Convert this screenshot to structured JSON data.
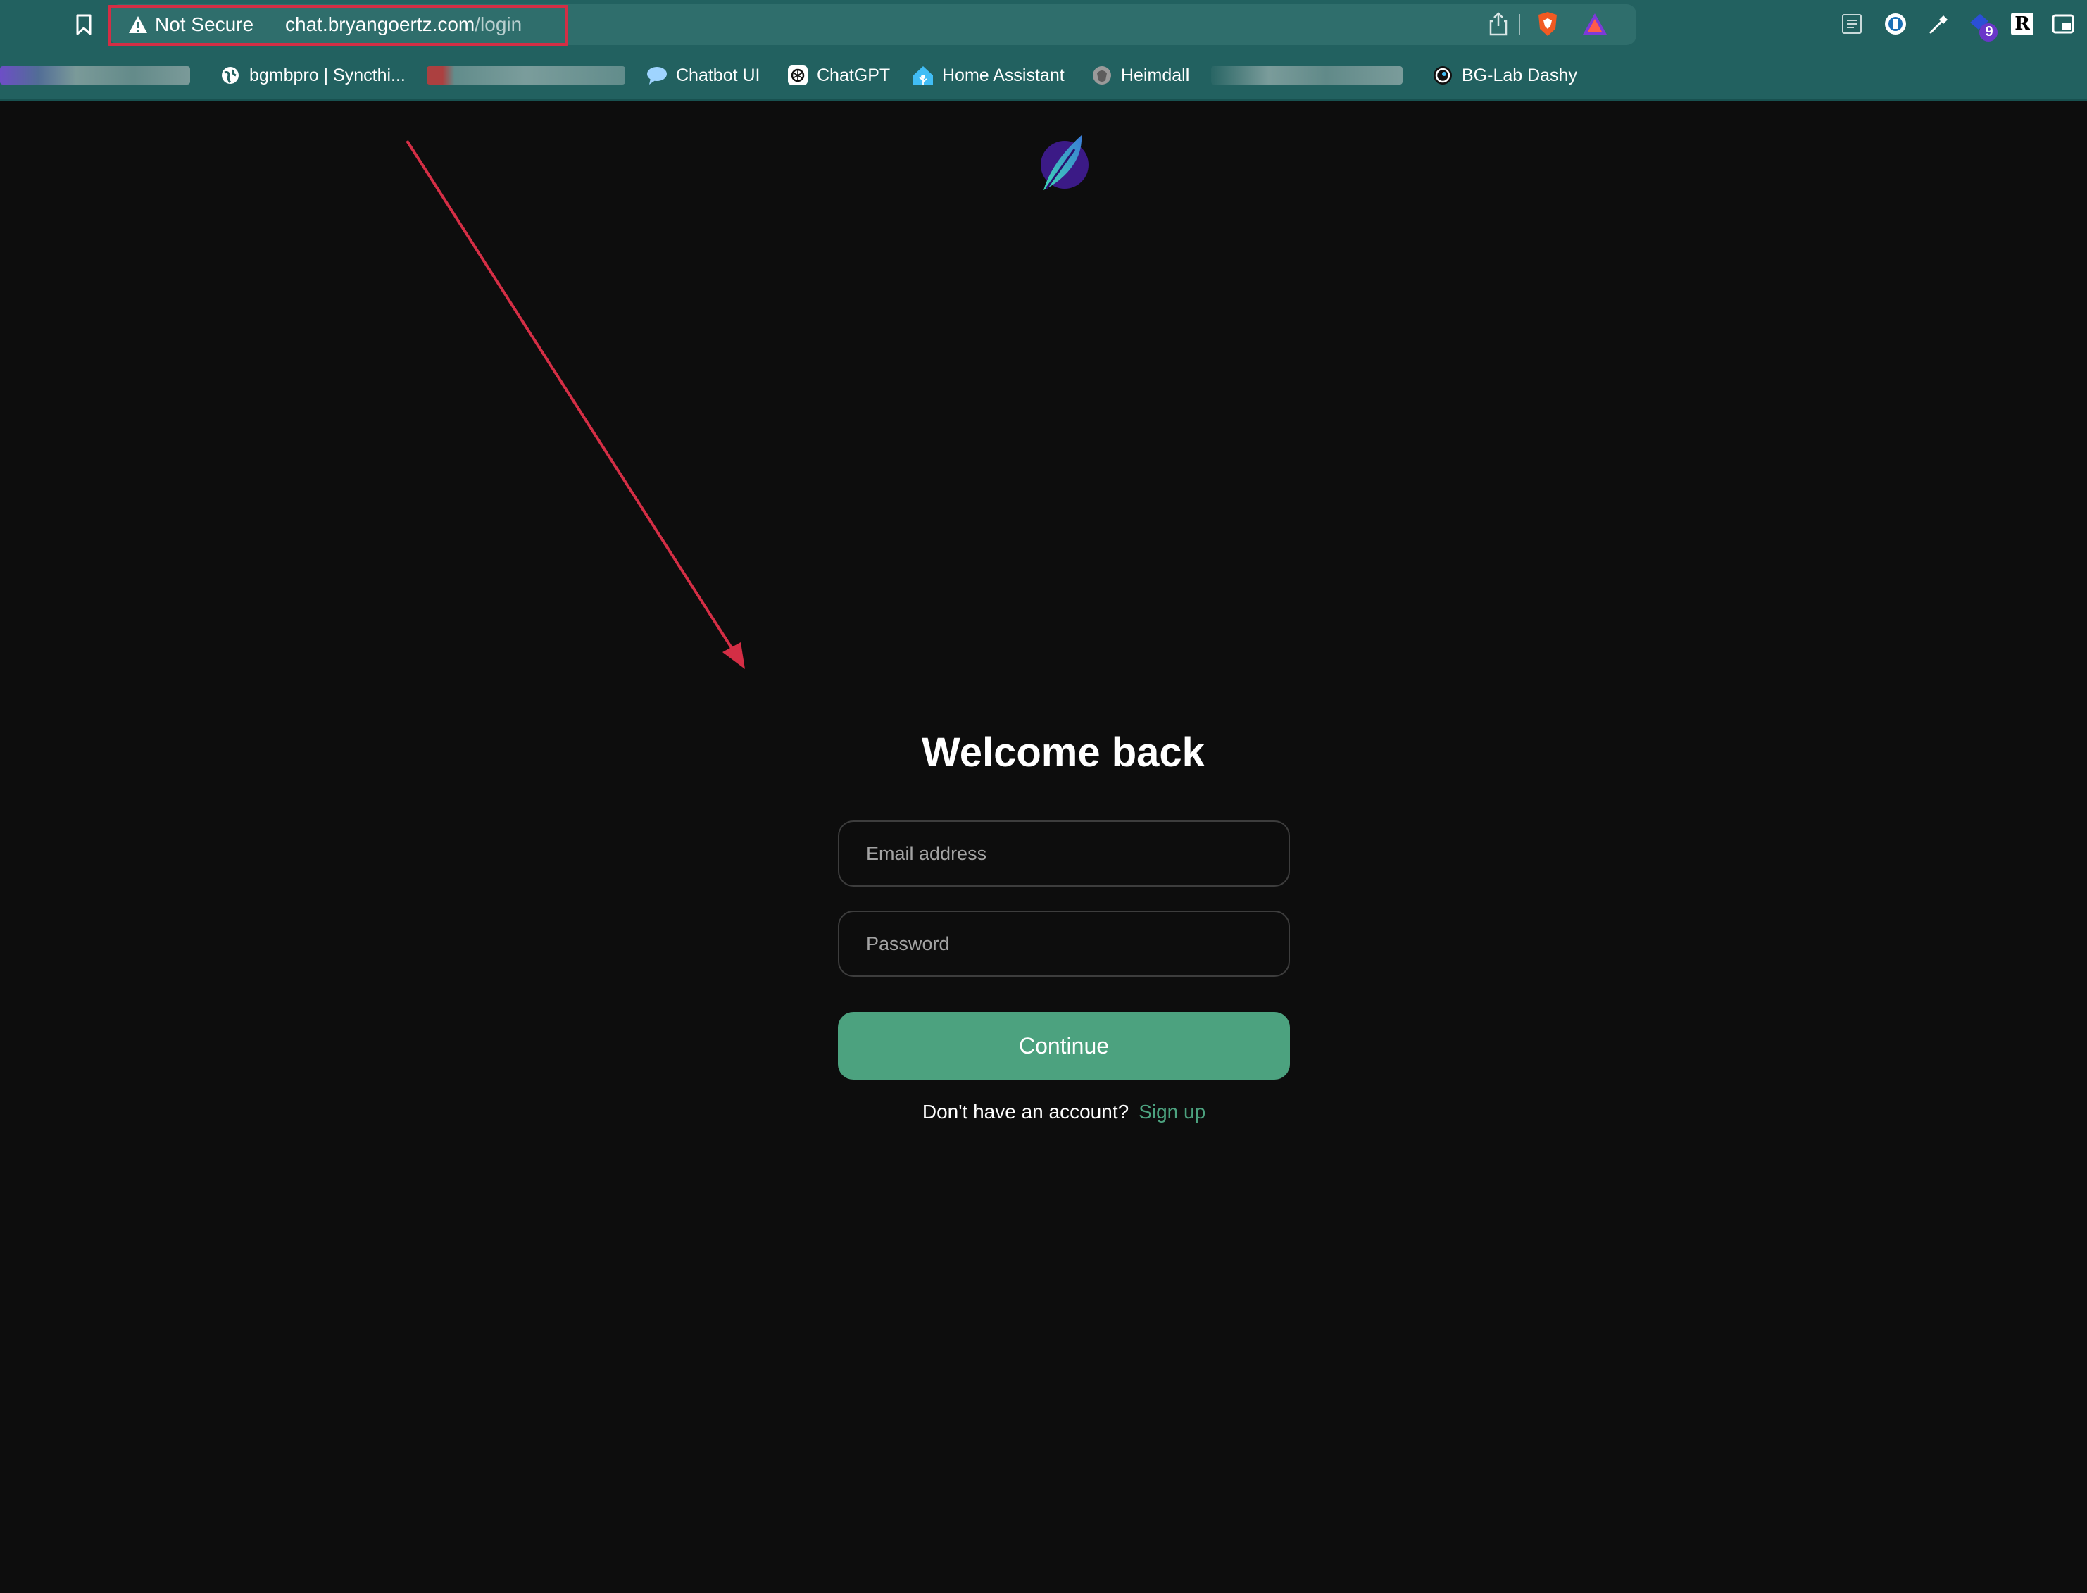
{
  "browser": {
    "security_label": "Not Secure",
    "url_host": "chat.bryangoertz.com",
    "url_path": "/login",
    "extension_badge": "9",
    "bookmarks": [
      {
        "label": "bgmbpro | Syncthi...",
        "icon": "globe-icon"
      },
      {
        "label": "Chatbot UI",
        "icon": "speech-bubble-icon"
      },
      {
        "label": "ChatGPT",
        "icon": "openai-icon"
      },
      {
        "label": "Home Assistant",
        "icon": "home-assistant-icon"
      },
      {
        "label": "Heimdall",
        "icon": "heimdall-icon"
      },
      {
        "label": "BG-Lab Dashy",
        "icon": "dashy-icon"
      }
    ]
  },
  "login": {
    "title": "Welcome back",
    "email_placeholder": "Email address",
    "password_placeholder": "Password",
    "continue_label": "Continue",
    "no_account_text": "Don't have an account?",
    "signup_label": "Sign up"
  },
  "colors": {
    "chrome": "#226160",
    "page_background": "#0d0d0d",
    "accent_green": "#4ca27f",
    "annotation_red": "#d42e45"
  }
}
